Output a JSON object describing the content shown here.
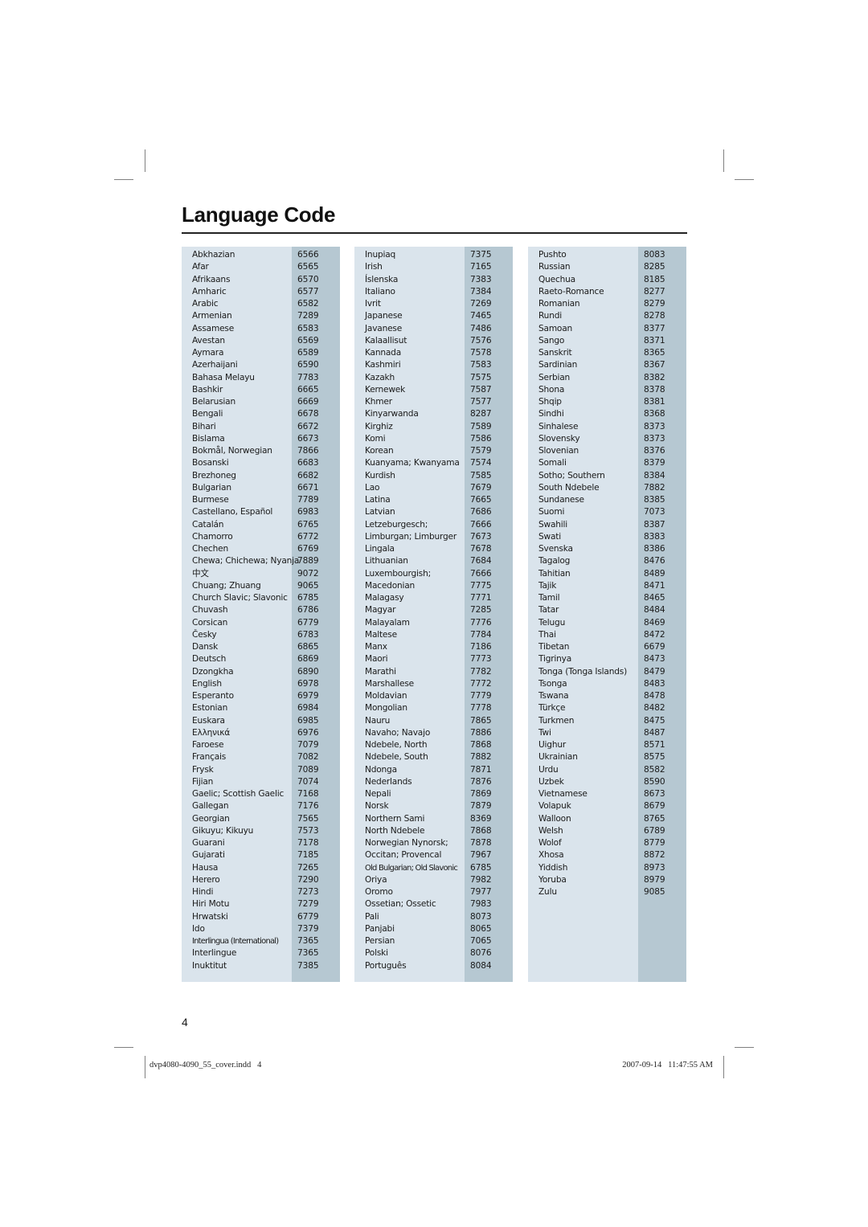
{
  "title": "Language Code",
  "page_number": "4",
  "footer": {
    "file": "dvp4080-4090_55_cover.indd   4",
    "timestamp": "2007-09-14   11:47:55 AM"
  },
  "columns": [
    {
      "rows": [
        {
          "lang": "Abkhazian",
          "code": "6566"
        },
        {
          "lang": "Afar",
          "code": "6565"
        },
        {
          "lang": "Afrikaans",
          "code": "6570"
        },
        {
          "lang": "Amharic",
          "code": "6577"
        },
        {
          "lang": "Arabic",
          "code": "6582"
        },
        {
          "lang": "Armenian",
          "code": "7289"
        },
        {
          "lang": "Assamese",
          "code": "6583"
        },
        {
          "lang": "Avestan",
          "code": "6569"
        },
        {
          "lang": "Aymara",
          "code": "6589"
        },
        {
          "lang": "Azerhaijani",
          "code": "6590"
        },
        {
          "lang": "Bahasa Melayu",
          "code": "7783"
        },
        {
          "lang": "Bashkir",
          "code": "6665"
        },
        {
          "lang": "Belarusian",
          "code": "6669"
        },
        {
          "lang": "Bengali",
          "code": "6678"
        },
        {
          "lang": "Bihari",
          "code": "6672"
        },
        {
          "lang": "Bislama",
          "code": "6673"
        },
        {
          "lang": "Bokmål, Norwegian",
          "code": "7866"
        },
        {
          "lang": "Bosanski",
          "code": "6683"
        },
        {
          "lang": "Brezhoneg",
          "code": "6682"
        },
        {
          "lang": "Bulgarian",
          "code": "6671"
        },
        {
          "lang": "Burmese",
          "code": "7789"
        },
        {
          "lang": "Castellano, Español",
          "code": "6983"
        },
        {
          "lang": "Catalán",
          "code": "6765"
        },
        {
          "lang": "Chamorro",
          "code": "6772"
        },
        {
          "lang": "Chechen",
          "code": "6769"
        },
        {
          "lang": "Chewa; Chichewa; Nyanja",
          "code": "7889"
        },
        {
          "lang": "中文",
          "code": "9072"
        },
        {
          "lang": "Chuang; Zhuang",
          "code": "9065"
        },
        {
          "lang": "Church Slavic; Slavonic",
          "code": "6785"
        },
        {
          "lang": "Chuvash",
          "code": "6786"
        },
        {
          "lang": "Corsican",
          "code": "6779"
        },
        {
          "lang": "Česky",
          "code": "6783"
        },
        {
          "lang": "Dansk",
          "code": "6865"
        },
        {
          "lang": "Deutsch",
          "code": "6869"
        },
        {
          "lang": "Dzongkha",
          "code": "6890"
        },
        {
          "lang": "English",
          "code": "6978"
        },
        {
          "lang": "Esperanto",
          "code": "6979"
        },
        {
          "lang": "Estonian",
          "code": "6984"
        },
        {
          "lang": "Euskara",
          "code": "6985"
        },
        {
          "lang": "Ελληνικά",
          "code": "6976"
        },
        {
          "lang": "Faroese",
          "code": "7079"
        },
        {
          "lang": "Français",
          "code": "7082"
        },
        {
          "lang": "Frysk",
          "code": "7089"
        },
        {
          "lang": "Fijian",
          "code": "7074"
        },
        {
          "lang": "Gaelic; Scottish Gaelic",
          "code": "7168"
        },
        {
          "lang": "Gallegan",
          "code": "7176"
        },
        {
          "lang": "Georgian",
          "code": "7565"
        },
        {
          "lang": "Gikuyu; Kikuyu",
          "code": "7573"
        },
        {
          "lang": "Guarani",
          "code": "7178"
        },
        {
          "lang": "Gujarati",
          "code": "7185"
        },
        {
          "lang": "Hausa",
          "code": "7265"
        },
        {
          "lang": "Herero",
          "code": "7290"
        },
        {
          "lang": "Hindi",
          "code": "7273"
        },
        {
          "lang": "Hiri Motu",
          "code": "7279"
        },
        {
          "lang": "Hrwatski",
          "code": "6779"
        },
        {
          "lang": "Ido",
          "code": "7379"
        },
        {
          "lang": "Interlingua (International)",
          "code": "7365"
        },
        {
          "lang": "Interlingue",
          "code": "7365"
        },
        {
          "lang": "Inuktitut",
          "code": "7385"
        }
      ]
    },
    {
      "rows": [
        {
          "lang": "Inupiaq",
          "code": "7375"
        },
        {
          "lang": "Irish",
          "code": "7165"
        },
        {
          "lang": "Íslenska",
          "code": "7383"
        },
        {
          "lang": "Italiano",
          "code": "7384"
        },
        {
          "lang": "Ivrit",
          "code": "7269"
        },
        {
          "lang": "Japanese",
          "code": "7465"
        },
        {
          "lang": "Javanese",
          "code": "7486"
        },
        {
          "lang": "Kalaallisut",
          "code": "7576"
        },
        {
          "lang": "Kannada",
          "code": "7578"
        },
        {
          "lang": "Kashmiri",
          "code": "7583"
        },
        {
          "lang": "Kazakh",
          "code": "7575"
        },
        {
          "lang": "Kernewek",
          "code": "7587"
        },
        {
          "lang": "Khmer",
          "code": "7577"
        },
        {
          "lang": "Kinyarwanda",
          "code": "8287"
        },
        {
          "lang": "Kirghiz",
          "code": "7589"
        },
        {
          "lang": "Komi",
          "code": "7586"
        },
        {
          "lang": "Korean",
          "code": "7579"
        },
        {
          "lang": "Kuanyama; Kwanyama",
          "code": "7574"
        },
        {
          "lang": "Kurdish",
          "code": "7585"
        },
        {
          "lang": "Lao",
          "code": "7679"
        },
        {
          "lang": "Latina",
          "code": "7665"
        },
        {
          "lang": "Latvian",
          "code": "7686"
        },
        {
          "lang": "Letzeburgesch;",
          "code": "7666"
        },
        {
          "lang": "Limburgan; Limburger",
          "code": "7673"
        },
        {
          "lang": "Lingala",
          "code": "7678"
        },
        {
          "lang": "Lithuanian",
          "code": "7684"
        },
        {
          "lang": "Luxembourgish;",
          "code": "7666"
        },
        {
          "lang": "Macedonian",
          "code": "7775"
        },
        {
          "lang": "Malagasy",
          "code": "7771"
        },
        {
          "lang": "Magyar",
          "code": "7285"
        },
        {
          "lang": "Malayalam",
          "code": "7776"
        },
        {
          "lang": "Maltese",
          "code": "7784"
        },
        {
          "lang": "Manx",
          "code": "7186"
        },
        {
          "lang": "Maori",
          "code": "7773"
        },
        {
          "lang": "Marathi",
          "code": "7782"
        },
        {
          "lang": "Marshallese",
          "code": "7772"
        },
        {
          "lang": "Moldavian",
          "code": "7779"
        },
        {
          "lang": "Mongolian",
          "code": "7778"
        },
        {
          "lang": "Nauru",
          "code": "7865"
        },
        {
          "lang": "Navaho; Navajo",
          "code": "7886"
        },
        {
          "lang": "Ndebele, North",
          "code": "7868"
        },
        {
          "lang": "Ndebele, South",
          "code": "7882"
        },
        {
          "lang": "Ndonga",
          "code": "7871"
        },
        {
          "lang": "Nederlands",
          "code": "7876"
        },
        {
          "lang": "Nepali",
          "code": "7869"
        },
        {
          "lang": "Norsk",
          "code": "7879"
        },
        {
          "lang": "Northern Sami",
          "code": "8369"
        },
        {
          "lang": "North Ndebele",
          "code": "7868"
        },
        {
          "lang": "Norwegian Nynorsk;",
          "code": "7878"
        },
        {
          "lang": "Occitan; Provencal",
          "code": "7967"
        },
        {
          "lang": "Old Bulgarian; Old Slavonic",
          "code": "6785"
        },
        {
          "lang": "Oriya",
          "code": "7982"
        },
        {
          "lang": "Oromo",
          "code": "7977"
        },
        {
          "lang": "Ossetian; Ossetic",
          "code": "7983"
        },
        {
          "lang": "Pali",
          "code": "8073"
        },
        {
          "lang": "Panjabi",
          "code": "8065"
        },
        {
          "lang": "Persian",
          "code": "7065"
        },
        {
          "lang": "Polski",
          "code": "8076"
        },
        {
          "lang": "Português",
          "code": "8084"
        }
      ]
    },
    {
      "rows": [
        {
          "lang": "Pushto",
          "code": "8083"
        },
        {
          "lang": "Russian",
          "code": "8285"
        },
        {
          "lang": "Quechua",
          "code": "8185"
        },
        {
          "lang": "Raeto-Romance",
          "code": "8277"
        },
        {
          "lang": "Romanian",
          "code": "8279"
        },
        {
          "lang": "Rundi",
          "code": "8278"
        },
        {
          "lang": "Samoan",
          "code": "8377"
        },
        {
          "lang": "Sango",
          "code": "8371"
        },
        {
          "lang": "Sanskrit",
          "code": "8365"
        },
        {
          "lang": "Sardinian",
          "code": "8367"
        },
        {
          "lang": "Serbian",
          "code": "8382"
        },
        {
          "lang": "Shona",
          "code": "8378"
        },
        {
          "lang": "Shqip",
          "code": "8381"
        },
        {
          "lang": "Sindhi",
          "code": "8368"
        },
        {
          "lang": "Sinhalese",
          "code": "8373"
        },
        {
          "lang": "Slovensky",
          "code": "8373"
        },
        {
          "lang": "Slovenian",
          "code": "8376"
        },
        {
          "lang": "Somali",
          "code": "8379"
        },
        {
          "lang": "Sotho; Southern",
          "code": "8384"
        },
        {
          "lang": "South Ndebele",
          "code": "7882"
        },
        {
          "lang": "Sundanese",
          "code": "8385"
        },
        {
          "lang": "Suomi",
          "code": "7073"
        },
        {
          "lang": "Swahili",
          "code": "8387"
        },
        {
          "lang": "Swati",
          "code": "8383"
        },
        {
          "lang": "Svenska",
          "code": "8386"
        },
        {
          "lang": "Tagalog",
          "code": "8476"
        },
        {
          "lang": "Tahitian",
          "code": "8489"
        },
        {
          "lang": "Tajik",
          "code": "8471"
        },
        {
          "lang": "Tamil",
          "code": "8465"
        },
        {
          "lang": "Tatar",
          "code": "8484"
        },
        {
          "lang": "Telugu",
          "code": "8469"
        },
        {
          "lang": "Thai",
          "code": "8472"
        },
        {
          "lang": "Tibetan",
          "code": "6679"
        },
        {
          "lang": "Tigrinya",
          "code": "8473"
        },
        {
          "lang": "Tonga (Tonga Islands)",
          "code": "8479"
        },
        {
          "lang": "Tsonga",
          "code": "8483"
        },
        {
          "lang": "Tswana",
          "code": "8478"
        },
        {
          "lang": "Türkçe",
          "code": "8482"
        },
        {
          "lang": "Turkmen",
          "code": "8475"
        },
        {
          "lang": "Twi",
          "code": "8487"
        },
        {
          "lang": "Uighur",
          "code": "8571"
        },
        {
          "lang": "Ukrainian",
          "code": "8575"
        },
        {
          "lang": "Urdu",
          "code": "8582"
        },
        {
          "lang": "Uzbek",
          "code": "8590"
        },
        {
          "lang": "Vietnamese",
          "code": "8673"
        },
        {
          "lang": "Volapuk",
          "code": "8679"
        },
        {
          "lang": "Walloon",
          "code": "8765"
        },
        {
          "lang": "Welsh",
          "code": "6789"
        },
        {
          "lang": "Wolof",
          "code": "8779"
        },
        {
          "lang": "Xhosa",
          "code": "8872"
        },
        {
          "lang": "Yiddish",
          "code": "8973"
        },
        {
          "lang": "Yoruba",
          "code": "8979"
        },
        {
          "lang": "Zulu",
          "code": "9085"
        }
      ]
    }
  ]
}
